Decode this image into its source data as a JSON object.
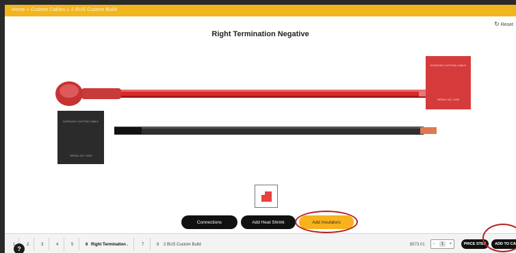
{
  "breadcrumb": "Home » Custom Cables » 2 BUS Custom Build",
  "title": "Right Termination Negative",
  "reset_label": "Reset",
  "cable_labels": {
    "red_box_top": "WORKING CUSTOM CABLE",
    "red_box_bottom": "SERIAL NO. 0000",
    "black_box_top": "WORKING CUSTOM CABLE",
    "black_box_bottom": "SERIAL NO. 0000"
  },
  "colors": {
    "accent": "#f3b51d",
    "cable_red": "#d82a2a",
    "cable_black": "#2e2e2e",
    "highlight_circle": "#b3211e"
  },
  "buttons": {
    "connections": "Connections",
    "heat_shrink": "Add Heat Shrink",
    "insulators": "Add Insulators"
  },
  "steps": [
    {
      "num": "1",
      "label": ""
    },
    {
      "num": "2",
      "label": ""
    },
    {
      "num": "3",
      "label": ""
    },
    {
      "num": "4",
      "label": ""
    },
    {
      "num": "5",
      "label": ""
    },
    {
      "num": "6",
      "label": "Right Termination ."
    },
    {
      "num": "7",
      "label": ""
    },
    {
      "num": "8",
      "label": "2 BUS Custom Build"
    }
  ],
  "help_icon": "?",
  "price_text": "$573.01",
  "quantity": {
    "minus": "−",
    "value": "1",
    "plus": "+"
  },
  "actions": {
    "price_label": "PRICE STEP",
    "add_to_cart": "ADD TO CART"
  }
}
